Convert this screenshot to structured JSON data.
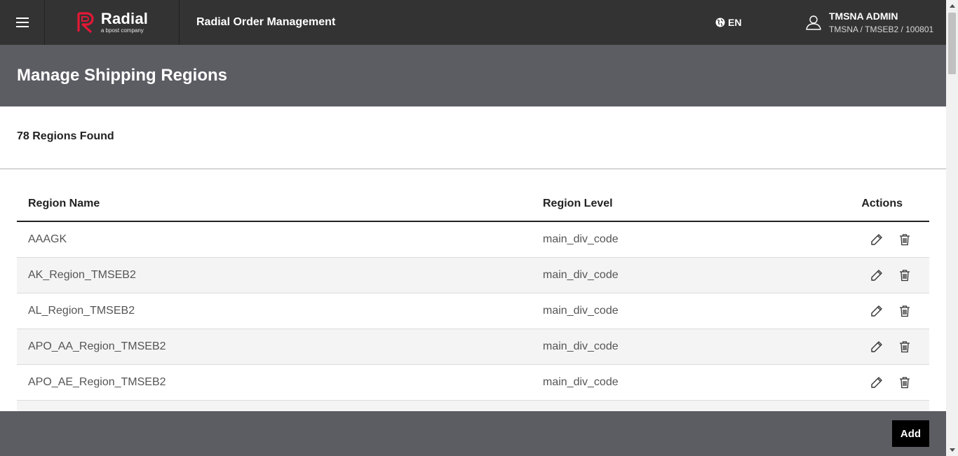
{
  "topbar": {
    "menu_icon": "hamburger-menu-icon",
    "logo": {
      "name": "Radial",
      "tagline": "a bpost company",
      "color": "#e31837"
    },
    "app_title": "Radial Order Management",
    "language": {
      "icon": "globe-icon",
      "label": "EN"
    },
    "user": {
      "icon": "user-icon",
      "name": "TMSNA ADMIN",
      "context": "TMSNA / TMSEB2 / 100801"
    }
  },
  "page": {
    "title": "Manage Shipping Regions",
    "count_label": "78 Regions Found"
  },
  "table": {
    "headers": {
      "name": "Region Name",
      "level": "Region Level",
      "actions": "Actions"
    },
    "rows": [
      {
        "name": "AAAGK",
        "level": "main_div_code"
      },
      {
        "name": "AK_Region_TMSEB2",
        "level": "main_div_code"
      },
      {
        "name": "AL_Region_TMSEB2",
        "level": "main_div_code"
      },
      {
        "name": "APO_AA_Region_TMSEB2",
        "level": "main_div_code"
      },
      {
        "name": "APO_AE_Region_TMSEB2",
        "level": "main_div_code"
      }
    ],
    "row_action_icons": [
      "pencil-edit-icon",
      "trash-delete-icon"
    ]
  },
  "footer": {
    "add_label": "Add"
  }
}
